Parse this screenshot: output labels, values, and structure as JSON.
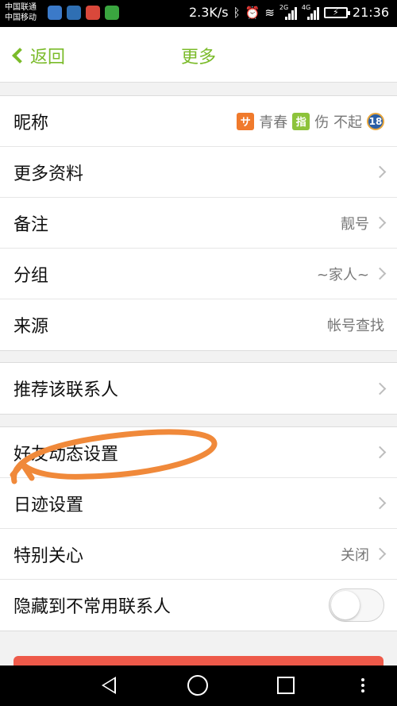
{
  "status_bar": {
    "carrier1": "中国联通",
    "carrier2": "中国移动",
    "speed": "2.3K/s",
    "net1": "2G",
    "net2": "4G",
    "time": "21:36"
  },
  "header": {
    "back_label": "返回",
    "title": "更多"
  },
  "group1": {
    "nickname": {
      "label": "昵称",
      "badge1": "サ",
      "part1": "青春",
      "badge2": "指",
      "part2": "伤 不起",
      "badge3": "18"
    },
    "more_info": {
      "label": "更多资料"
    },
    "remark": {
      "label": "备注",
      "value": "靓号"
    },
    "group": {
      "label": "分组",
      "value": "~家人~"
    },
    "source": {
      "label": "来源",
      "value": "帐号查找"
    }
  },
  "group2": {
    "recommend": {
      "label": "推荐该联系人"
    }
  },
  "group3": {
    "friend_feed": {
      "label": "好友动态设置"
    },
    "footprint": {
      "label": "日迹设置"
    },
    "special_care": {
      "label": "特别关心",
      "value": "关闭"
    },
    "hide_contact": {
      "label": "隐藏到不常用联系人",
      "toggle_on": false
    }
  },
  "colors": {
    "accent_green": "#7bbb2a",
    "annotation_orange": "#f0893a",
    "danger_red": "#ee5a4a"
  }
}
